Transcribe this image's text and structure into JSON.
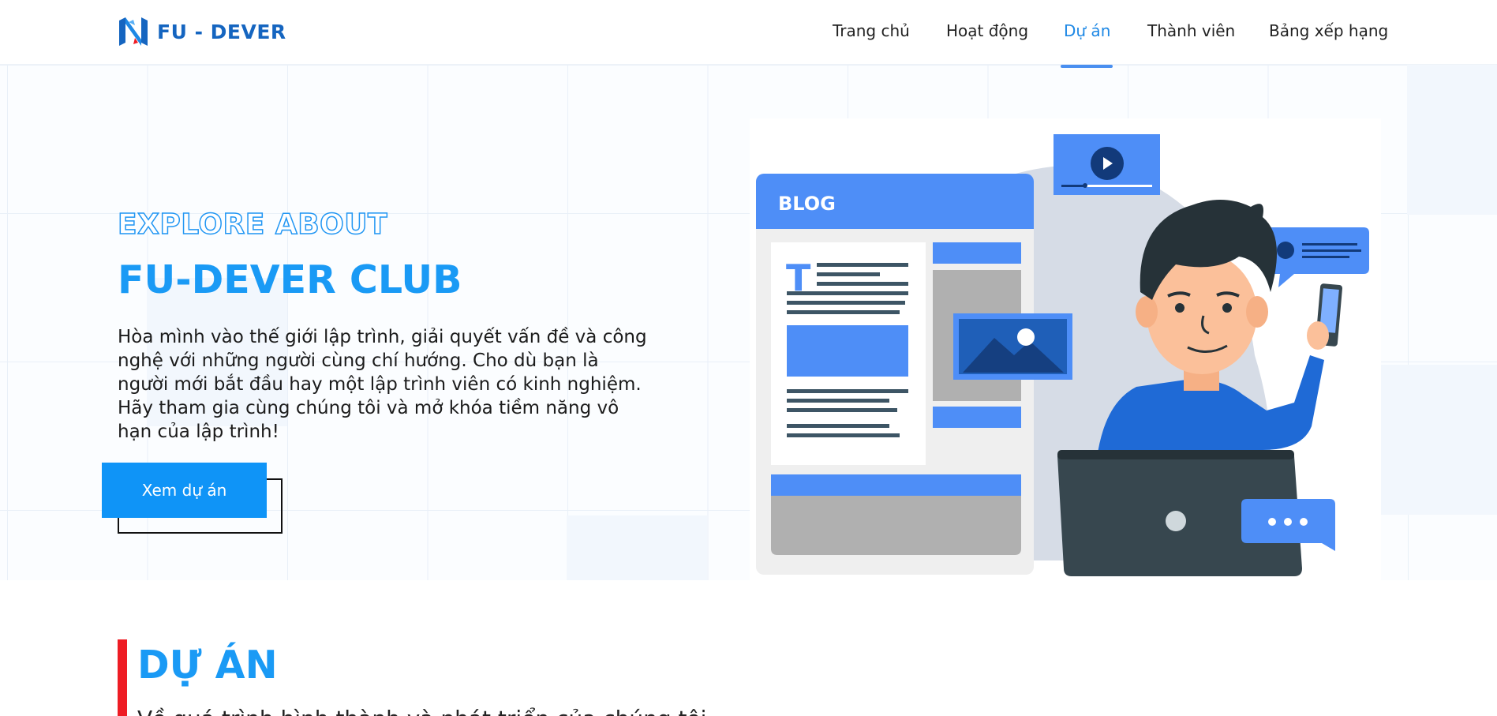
{
  "header": {
    "logo_text": "FU - DEVER",
    "nav": [
      {
        "label": "Trang chủ",
        "active": false
      },
      {
        "label": "Hoạt động",
        "active": false
      },
      {
        "label": "Dự án",
        "active": true
      },
      {
        "label": "Thành viên",
        "active": false
      },
      {
        "label": "Bảng xếp hạng",
        "active": false
      }
    ]
  },
  "hero": {
    "eyebrow": "EXPLORE ABOUT",
    "title": "FU-DEVER CLUB",
    "description": "Hòa mình vào thế giới lập trình, giải quyết vấn đề và công nghệ với những người cùng chí hướng. Cho dù bạn là người mới bắt đầu hay một lập trình viên có kinh nghiệm. Hãy tham gia cùng chúng tôi và mở khóa tiềm năng vô hạn của lập trình!",
    "cta_label": "Xem dự án",
    "illustration": {
      "blog_label": "BLOG",
      "text_glyph": "T"
    }
  },
  "section": {
    "title": "DỰ ÁN",
    "subtitle": "Về quá trình hình thành và phát triển của chúng tôi"
  },
  "colors": {
    "brand_blue": "#1a9af5",
    "logo_blue": "#1565c0",
    "accent_red": "#ee1c24",
    "illustration_blue": "#4e8ef7"
  }
}
